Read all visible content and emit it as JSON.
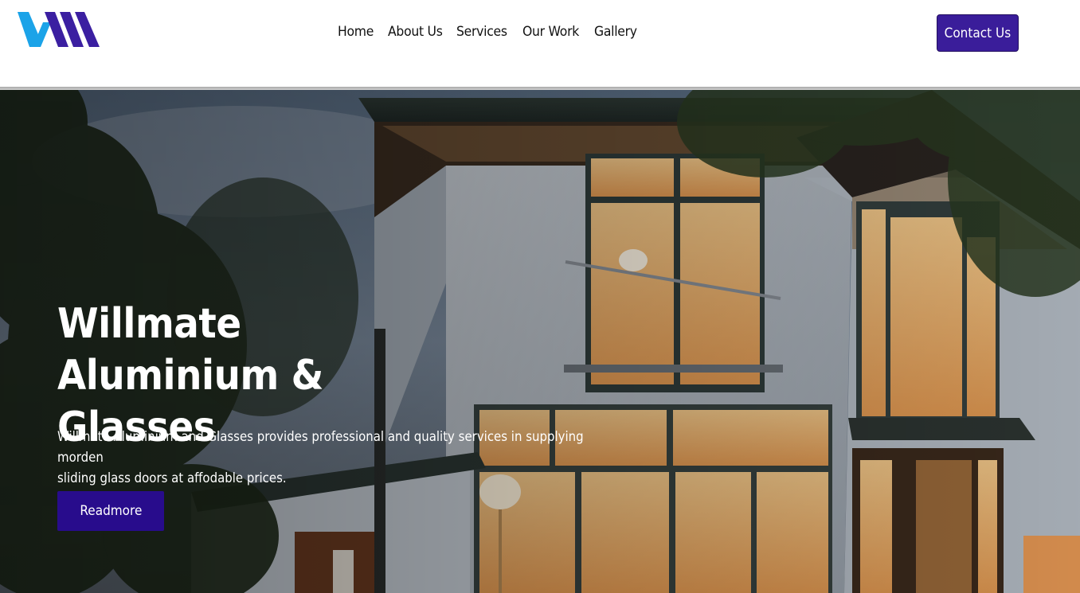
{
  "header": {
    "logo_icon": "wm-logo-icon",
    "nav": [
      {
        "label": "Home"
      },
      {
        "label": "About Us"
      },
      {
        "label": "Services"
      },
      {
        "label": "Our Work"
      },
      {
        "label": "Gallery"
      }
    ],
    "contact_label": "Contact Us"
  },
  "hero": {
    "title_line1": "Willmate Aluminium &",
    "title_line2": "Glasses",
    "description_line1": "Willmate Aluminium and Glasses provides professional and quality services in supplying morden",
    "description_line2": "sliding glass doors at affodable prices.",
    "readmore_label": "Readmore"
  },
  "colors": {
    "brand_purple": "#3a1d9a",
    "button_purple": "#280c8c",
    "logo_blue": "#1ba3e8",
    "logo_purple": "#3b1fa1"
  }
}
